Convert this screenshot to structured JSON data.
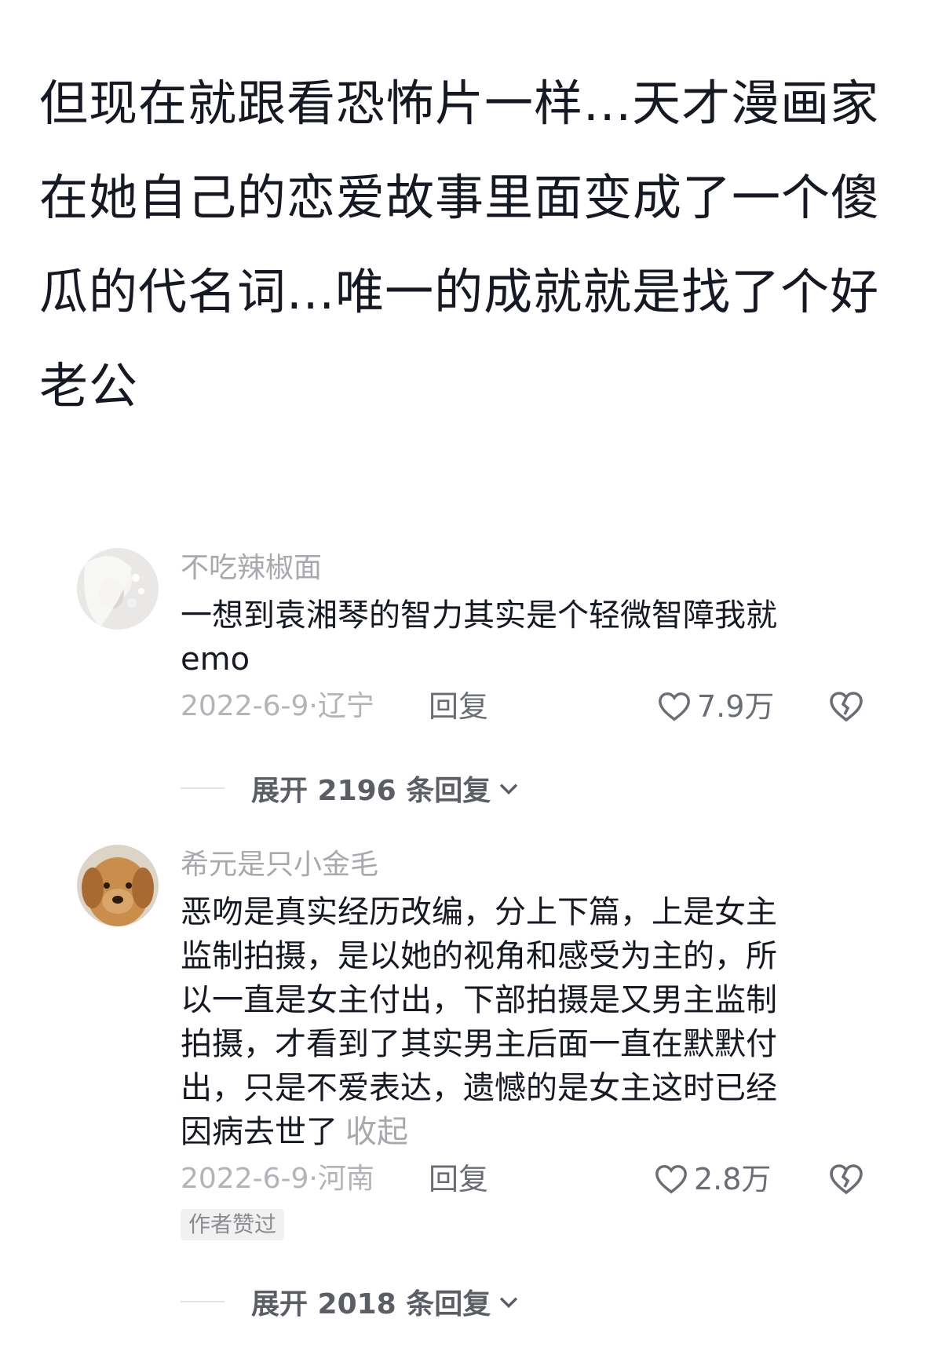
{
  "caption": {
    "lines": [
      "但现在就跟看恐怖片一样...天才漫画家",
      "在她自己的恋爱故事里面变成了一个傻",
      "瓜的代名词...唯一的成就就是找了个好",
      "老公"
    ]
  },
  "comments": [
    {
      "username": "不吃辣椒面",
      "avatar_icon": "avatar-white-hair-girl-icon",
      "content_lines": [
        "一想到袁湘琴的智力其实是个轻微智障我就",
        "emo"
      ],
      "meta": "2022-6-9·辽宁",
      "reply_label": "回复",
      "likes": "7.9万",
      "expand_label": "展开 2196 条回复"
    },
    {
      "username": "希元是只小金毛",
      "avatar_icon": "avatar-golden-retriever-icon",
      "content_lines": [
        "恶吻是真实经历改编，分上下篇，上是女主",
        "监制拍摄，是以她的视角和感受为主的，所",
        "以一直是女主付出，下部拍摄是又男主监制",
        "拍摄，才看到了其实男主后面一直在默默付",
        "出，只是不爱表达，遗憾的是女主这时已经",
        "因病去世了"
      ],
      "collapse_label": "收起",
      "meta": "2022-6-9·河南",
      "reply_label": "回复",
      "likes": "2.8万",
      "author_badge": "作者赞过",
      "expand_label": "展开 2018 条回复"
    }
  ],
  "colors": {
    "text": "#161823",
    "secondary": "#a8a8ad",
    "icon": "#6b6d75"
  }
}
